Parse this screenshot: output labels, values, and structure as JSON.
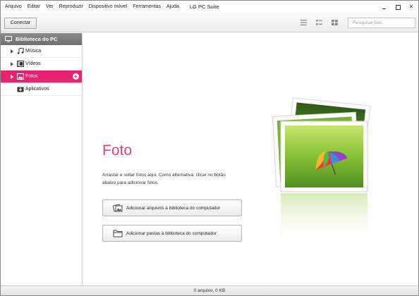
{
  "menu": {
    "items": [
      "Arquivo",
      "Editar",
      "Ver",
      "Reproduzir",
      "Dispositivo móvel",
      "Ferramentas",
      "Ajuda"
    ],
    "app_title": "LG PC Suite"
  },
  "window_controls": {
    "minimize": "minimize-icon",
    "maximize": "maximize-icon",
    "close": "✕"
  },
  "toolbar": {
    "connect_label": "Conectar",
    "view_icons": [
      "list-view-icon",
      "detail-view-icon",
      "grid-view-icon"
    ],
    "search_placeholder": "Pesquisar foto"
  },
  "sidebar": {
    "header": "Biblioteca do PC",
    "items": [
      {
        "label": "Música",
        "icon": "music-icon",
        "selected": false
      },
      {
        "label": "Vídeos",
        "icon": "video-icon",
        "selected": false
      },
      {
        "label": "Fotos",
        "icon": "photo-icon",
        "selected": true
      },
      {
        "label": "Aplicativos",
        "icon": "app-icon",
        "selected": false
      }
    ]
  },
  "main": {
    "title": "Foto",
    "description": "Arrastar e soltar fotos aqui. Como alternativa, clicar no botão abaixo para adicionar fotos.",
    "add_files_label": "Adicionar arquivos à biblioteca do computador",
    "add_folders_label": "Adicionar pastas à biblioteca do computador"
  },
  "status": {
    "text": "0 arquivo, 0 KB"
  },
  "colors": {
    "accent": "#e8236f",
    "title": "#e2437f",
    "header_bg": "#7d7d7d"
  }
}
